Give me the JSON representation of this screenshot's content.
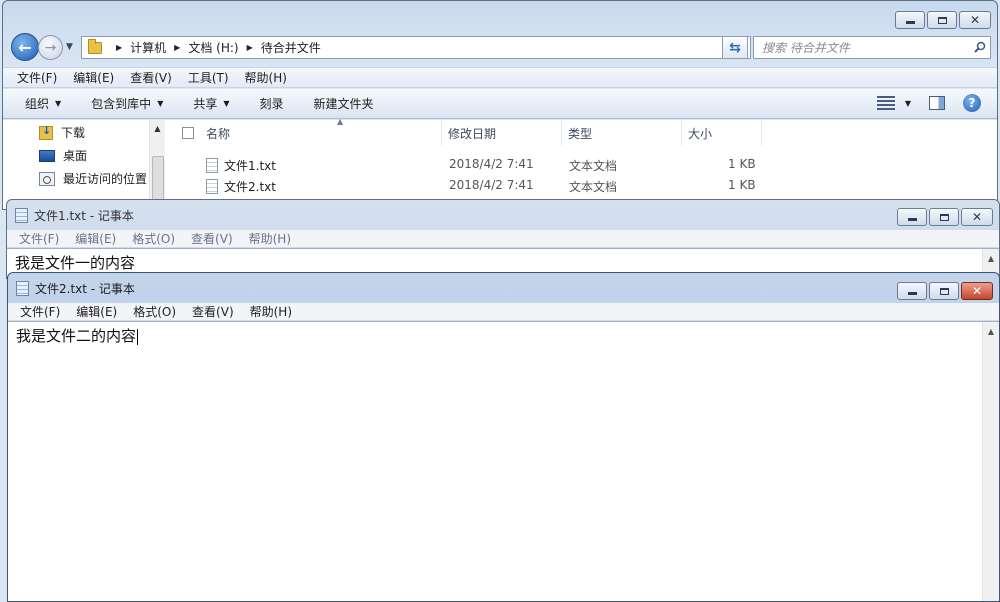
{
  "explorer": {
    "address": {
      "crumbs": [
        "计算机",
        "文档 (H:)",
        "待合并文件"
      ]
    },
    "search_placeholder": "搜索 待合并文件",
    "menu": [
      "文件(F)",
      "编辑(E)",
      "查看(V)",
      "工具(T)",
      "帮助(H)"
    ],
    "toolbar": {
      "organize": "组织",
      "include_in_library": "包含到库中",
      "share": "共享",
      "burn": "刻录",
      "new_folder": "新建文件夹"
    },
    "nav_pane": [
      "下载",
      "桌面",
      "最近访问的位置"
    ],
    "columns": {
      "name": "名称",
      "date": "修改日期",
      "type": "类型",
      "size": "大小"
    },
    "files": [
      {
        "name": "文件1.txt",
        "date": "2018/4/2 7:41",
        "type": "文本文档",
        "size": "1 KB"
      },
      {
        "name": "文件2.txt",
        "date": "2018/4/2 7:41",
        "type": "文本文档",
        "size": "1 KB"
      }
    ]
  },
  "notepad1": {
    "title": "文件1.txt - 记事本",
    "menu": [
      "文件(F)",
      "编辑(E)",
      "格式(O)",
      "查看(V)",
      "帮助(H)"
    ],
    "content": "我是文件一的内容"
  },
  "notepad2": {
    "title": "文件2.txt - 记事本",
    "menu": [
      "文件(F)",
      "编辑(E)",
      "格式(O)",
      "查看(V)",
      "帮助(H)"
    ],
    "content": "我是文件二的内容"
  },
  "colors": {
    "accent_blue": "#1d5bb0",
    "close_active": "#c5452c",
    "chrome_light": "#dbe6f3"
  }
}
